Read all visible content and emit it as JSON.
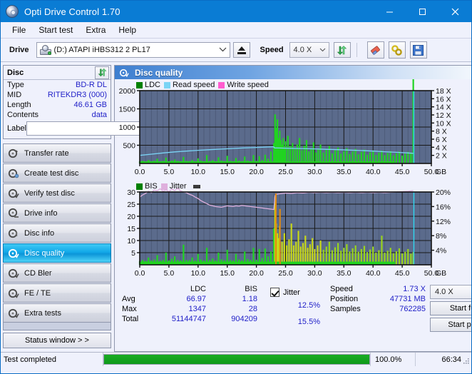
{
  "window": {
    "title": "Opti Drive Control 1.70",
    "icon": "disc-icon",
    "minimize": "minimize-icon",
    "maximize": "maximize-icon",
    "close": "close-icon"
  },
  "menu": {
    "items": [
      {
        "label": "File"
      },
      {
        "label": "Start test"
      },
      {
        "label": "Extra"
      },
      {
        "label": "Help"
      }
    ]
  },
  "toolbar": {
    "drive_label": "Drive",
    "drive_value": "(D:)  ATAPI iHBS312  2 PL17",
    "eject_icon": "eject-icon",
    "speed_label": "Speed",
    "speed_value": "4.0 X",
    "refresh_icon": "refresh-icon",
    "erase_icon": "eraser-icon",
    "links_icon": "chain-links-icon",
    "save_icon": "floppy-save-icon"
  },
  "disc_panel": {
    "title": "Disc",
    "refresh_icon": "refresh-icon",
    "rows": [
      {
        "key": "Type",
        "value": "BD-R DL"
      },
      {
        "key": "MID",
        "value": "RITEKDR3 (000)"
      },
      {
        "key": "Length",
        "value": "46.61 GB"
      },
      {
        "key": "Contents",
        "value": "data"
      }
    ],
    "label_key": "Label",
    "label_value": "",
    "label_placeholder": "",
    "label_button_icon": "cd-disc-icon"
  },
  "sidebar": {
    "items": [
      {
        "label": "Transfer rate",
        "icon": "disc-arrow-icon",
        "active": false
      },
      {
        "label": "Create test disc",
        "icon": "disc-write-icon",
        "active": false
      },
      {
        "label": "Verify test disc",
        "icon": "disc-check-icon",
        "active": false
      },
      {
        "label": "Drive info",
        "icon": "drive-info-icon",
        "active": false
      },
      {
        "label": "Disc info",
        "icon": "disc-info-icon",
        "active": false
      },
      {
        "label": "Disc quality",
        "icon": "disc-quality-icon",
        "active": true
      },
      {
        "label": "CD Bler",
        "icon": "disc-bler-icon",
        "active": false
      },
      {
        "label": "FE / TE",
        "icon": "disc-fete-icon",
        "active": false
      },
      {
        "label": "Extra tests",
        "icon": "disc-extra-icon",
        "active": false
      }
    ],
    "status_window_button": "Status window > >"
  },
  "content": {
    "header_title": "Disc quality",
    "header_icon": "disc-quality-icon"
  },
  "stats": {
    "columns": [
      "LDC",
      "BIS"
    ],
    "rows": [
      {
        "label": "Avg",
        "ldc": "66.97",
        "bis": "1.18"
      },
      {
        "label": "Max",
        "ldc": "1347",
        "bis": "28"
      },
      {
        "label": "Total",
        "ldc": "51144747",
        "bis": "904209"
      }
    ],
    "jitter": {
      "checkbox_checked": true,
      "label": "Jitter",
      "avg": "12.5%",
      "max": "15.5%"
    },
    "speed_label": "Speed",
    "speed_value": "1.73 X",
    "position_label": "Position",
    "position_value": "47731 MB",
    "samples_label": "Samples",
    "samples_value": "762285",
    "speed_select_value": "4.0 X",
    "start_full_label": "Start full",
    "start_part_label": "Start part"
  },
  "statusbar": {
    "message": "Test completed",
    "progress_percent": 100.0,
    "percent_label": "100.0%",
    "elapsed": "66:34",
    "grip_icon": "resize-grip-icon"
  },
  "colors": {
    "accent": "#0a7cd4",
    "plot_bg": "#5b6b8c",
    "ldc_green": "#21d321",
    "bis_green": "#21d321",
    "read_speed": "#7ad4f5",
    "write_speed": "#ff5ccf",
    "jitter_pink": "#dfb0dd",
    "value_blue": "#2121c8",
    "progress_green": "#12a81d",
    "cursor_cyan": "#31d8f0",
    "spike_orange": "#e08a10"
  },
  "chart_data": [
    {
      "type": "area",
      "id": "top-chart",
      "title": "",
      "xlabel": "GB",
      "ylabel": "",
      "xlim": [
        0.0,
        50.0
      ],
      "xticks": [
        "0.0",
        "5.0",
        "10.0",
        "15.0",
        "20.0",
        "25.0",
        "30.0",
        "35.0",
        "40.0",
        "45.0",
        "50.0"
      ],
      "ylim": [
        0,
        2000
      ],
      "yticks": [
        "500",
        "1000",
        "1500",
        "2000"
      ],
      "y2lim": [
        0,
        18
      ],
      "y2ticks": [
        "2 X",
        "4 X",
        "6 X",
        "8 X",
        "10 X",
        "12 X",
        "14 X",
        "16 X",
        "18 X"
      ],
      "grid": true,
      "legend": [
        {
          "name": "LDC",
          "color": "#008000"
        },
        {
          "name": "Read speed",
          "color": "#7ad4f5"
        },
        {
          "name": "Write speed",
          "color": "#ff5ccf"
        }
      ],
      "series": [
        {
          "name": "LDC",
          "color": "#21d321",
          "x": [
            0.0,
            0.5,
            1.0,
            1.5,
            2.0,
            2.5,
            3.0,
            3.5,
            4.0,
            4.5,
            5.0,
            5.5,
            6.0,
            6.5,
            7.0,
            7.5,
            8.0,
            8.5,
            9.0,
            9.5,
            10.0,
            10.5,
            11.0,
            11.5,
            12.0,
            12.5,
            13.0,
            13.5,
            14.0,
            14.5,
            15.0,
            15.5,
            16.0,
            16.5,
            17.0,
            17.5,
            18.0,
            18.5,
            19.0,
            19.5,
            20.0,
            20.5,
            21.0,
            21.5,
            22.0,
            22.5,
            23.0,
            23.2,
            23.4,
            23.6,
            23.8,
            24.0,
            24.2,
            24.4,
            24.6,
            24.8,
            25.0,
            25.4,
            25.8,
            26.2,
            26.6,
            27.0,
            27.4,
            27.8,
            28.2,
            28.6,
            29.0,
            29.4,
            29.8,
            30.2,
            30.6,
            31.0,
            31.5,
            32.0,
            32.5,
            33.0,
            33.5,
            34.0,
            34.5,
            35.0,
            35.5,
            36.0,
            36.5,
            37.0,
            37.5,
            38.0,
            38.5,
            39.0,
            39.5,
            40.0,
            40.5,
            41.0,
            41.5,
            42.0,
            42.5,
            43.0,
            43.5,
            44.0,
            44.5,
            45.0,
            45.5,
            46.0,
            46.5,
            46.9
          ],
          "y": [
            60,
            70,
            55,
            95,
            60,
            75,
            130,
            60,
            70,
            160,
            60,
            80,
            110,
            70,
            60,
            180,
            70,
            65,
            95,
            60,
            140,
            75,
            60,
            230,
            70,
            90,
            60,
            170,
            80,
            65,
            210,
            70,
            60,
            150,
            75,
            60,
            190,
            80,
            65,
            230,
            70,
            200,
            95,
            240,
            130,
            330,
            560,
            1347,
            980,
            1210,
            700,
            900,
            640,
            520,
            700,
            420,
            610,
            760,
            480,
            560,
            420,
            520,
            700,
            360,
            490,
            640,
            330,
            420,
            580,
            300,
            400,
            520,
            300,
            390,
            480,
            280,
            360,
            440,
            270,
            340,
            420,
            260,
            330,
            400,
            250,
            320,
            380,
            240,
            310,
            360,
            230,
            300,
            350,
            230,
            290,
            340,
            220,
            280,
            330,
            215,
            270,
            320,
            300
          ]
        },
        {
          "name": "Read speed",
          "color": "#7ad4f5",
          "x": [
            0.0,
            2.0,
            4.0,
            6.0,
            8.0,
            10.0,
            12.0,
            14.0,
            16.0,
            18.0,
            20.0,
            22.0,
            23.0,
            23.1,
            24.0,
            26.0,
            28.0,
            30.0,
            32.0,
            34.0,
            36.0,
            38.0,
            40.0,
            42.0,
            44.0,
            46.0,
            46.9
          ],
          "y": [
            2.0,
            2.3,
            2.6,
            2.85,
            3.05,
            3.25,
            3.4,
            3.55,
            3.7,
            3.85,
            3.95,
            4.05,
            4.1,
            3.85,
            3.82,
            3.75,
            3.68,
            3.6,
            3.5,
            3.4,
            3.3,
            3.2,
            3.05,
            2.9,
            2.75,
            2.6,
            2.5
          ],
          "axis": "y2"
        }
      ],
      "cursor_x": 47.0
    },
    {
      "type": "area",
      "id": "bottom-chart",
      "title": "",
      "xlabel": "GB",
      "ylabel": "",
      "xlim": [
        0.0,
        50.0
      ],
      "xticks": [
        "0.0",
        "5.0",
        "10.0",
        "15.0",
        "20.0",
        "25.0",
        "30.0",
        "35.0",
        "40.0",
        "45.0",
        "50.0"
      ],
      "ylim": [
        0,
        30
      ],
      "yticks": [
        "5",
        "10",
        "15",
        "20",
        "25",
        "30"
      ],
      "y2lim": [
        0,
        20
      ],
      "y2ticks": [
        "4%",
        "8%",
        "12%",
        "16%",
        "20%"
      ],
      "grid": true,
      "legend": [
        {
          "name": "BIS",
          "color": "#008000"
        },
        {
          "name": "Jitter",
          "color": "#dfb0dd"
        }
      ],
      "series": [
        {
          "name": "BIS",
          "color": "#21d321",
          "x": [
            0.0,
            0.5,
            1.0,
            1.5,
            2.0,
            2.5,
            3.0,
            3.5,
            4.0,
            4.5,
            5.0,
            5.5,
            6.0,
            6.5,
            7.0,
            7.5,
            8.0,
            8.5,
            9.0,
            9.5,
            10.0,
            10.5,
            11.0,
            11.5,
            12.0,
            12.5,
            13.0,
            13.5,
            14.0,
            14.5,
            15.0,
            15.5,
            16.0,
            16.5,
            17.0,
            17.5,
            18.0,
            18.5,
            19.0,
            19.5,
            20.0,
            20.5,
            21.0,
            21.5,
            22.0,
            22.5,
            23.0,
            23.2,
            23.4,
            23.6,
            23.8,
            24.0,
            24.4,
            24.8,
            25.2,
            25.6,
            26.0,
            26.4,
            26.8,
            27.2,
            27.6,
            28.0,
            28.4,
            28.8,
            29.2,
            29.6,
            30.0,
            30.5,
            31.0,
            31.5,
            32.0,
            32.5,
            33.0,
            33.5,
            34.0,
            34.5,
            35.0,
            35.5,
            36.0,
            36.5,
            37.0,
            37.5,
            38.0,
            38.5,
            39.0,
            39.5,
            40.0,
            40.5,
            41.0,
            41.5,
            42.0,
            42.5,
            43.0,
            43.5,
            44.0,
            44.5,
            45.0,
            45.5,
            46.0,
            46.5,
            46.9
          ],
          "y": [
            1.5,
            2,
            1.6,
            3,
            1.8,
            2.2,
            4,
            1.7,
            2,
            5,
            1.8,
            2.5,
            3.5,
            2,
            1.8,
            8.3,
            2,
            1.9,
            3,
            1.8,
            4.5,
            2.2,
            1.8,
            7,
            2,
            2.6,
            1.8,
            5,
            2.3,
            1.9,
            6.2,
            2,
            1.8,
            4.5,
            2.2,
            1.8,
            5.5,
            2.4,
            2,
            7,
            2.1,
            6.5,
            2.8,
            6.7,
            3.5,
            5.5,
            15,
            28,
            17,
            13,
            11,
            16,
            9.5,
            13,
            8,
            10.5,
            17,
            8,
            9.5,
            14,
            7.5,
            9,
            12,
            7,
            8.5,
            11,
            6.5,
            8,
            10,
            6.2,
            7.5,
            9.5,
            6,
            7.2,
            9,
            5.8,
            7,
            8.5,
            5.5,
            6.8,
            8,
            5.4,
            6.5,
            7.8,
            5.2,
            6.3,
            7.5,
            5,
            6,
            12,
            5,
            5.8,
            7,
            4.8,
            5.6,
            6.8,
            4.7,
            5.4,
            6.5,
            4.6,
            5.2,
            6.2,
            5.5
          ]
        },
        {
          "name": "Jitter",
          "color": "#dfb0dd",
          "x": [
            0.0,
            0.5,
            1.0,
            1.5,
            2.0,
            2.5,
            3.0,
            3.5,
            4.0,
            4.5,
            5.0,
            5.5,
            6.0,
            6.5,
            7.0,
            7.5,
            8.0,
            8.5,
            9.0,
            9.5,
            10.0,
            10.5,
            11.0,
            11.5,
            12.0,
            12.5,
            13.0,
            13.5,
            14.0,
            14.5,
            15.0,
            15.5,
            16.0,
            16.5,
            17.0,
            17.5,
            18.0,
            18.5,
            19.0,
            19.5,
            20.0,
            20.5,
            21.0,
            21.5,
            22.0,
            22.5,
            23.0,
            23.2,
            23.5,
            24.0,
            25.0,
            26.0,
            27.0,
            28.0,
            29.0,
            30.0,
            31.0,
            32.0,
            33.0,
            34.0,
            35.0,
            36.0,
            37.0,
            38.0,
            39.0,
            40.0,
            41.0,
            42.0,
            43.0,
            44.0,
            45.0,
            46.0,
            46.9
          ],
          "y": [
            18.6,
            19.2,
            19.6,
            20.2,
            19.8,
            20.6,
            20.3,
            20.9,
            20.2,
            20.6,
            20.1,
            20.8,
            20.4,
            21.0,
            20.3,
            20.0,
            19.8,
            19.4,
            19.1,
            18.6,
            18.2,
            17.6,
            17.2,
            16.8,
            16.4,
            16.2,
            16.0,
            15.9,
            15.8,
            16.0,
            16.2,
            16.1,
            16.0,
            16.2,
            16.1,
            16.3,
            16.2,
            16.1,
            16.0,
            15.9,
            15.8,
            15.7,
            15.6,
            15.5,
            15.4,
            15.3,
            15.2,
            19.0,
            19.4,
            19.5,
            19.7,
            19.6,
            19.8,
            19.7,
            19.9,
            19.8,
            19.9,
            19.8,
            19.9,
            19.8,
            19.9,
            19.8,
            19.9,
            19.8,
            19.9,
            19.8,
            19.9,
            19.8,
            19.9,
            20.0,
            20.1,
            20.2,
            20.4
          ],
          "axis": "y2"
        }
      ],
      "cursor_x": 47.0
    }
  ]
}
